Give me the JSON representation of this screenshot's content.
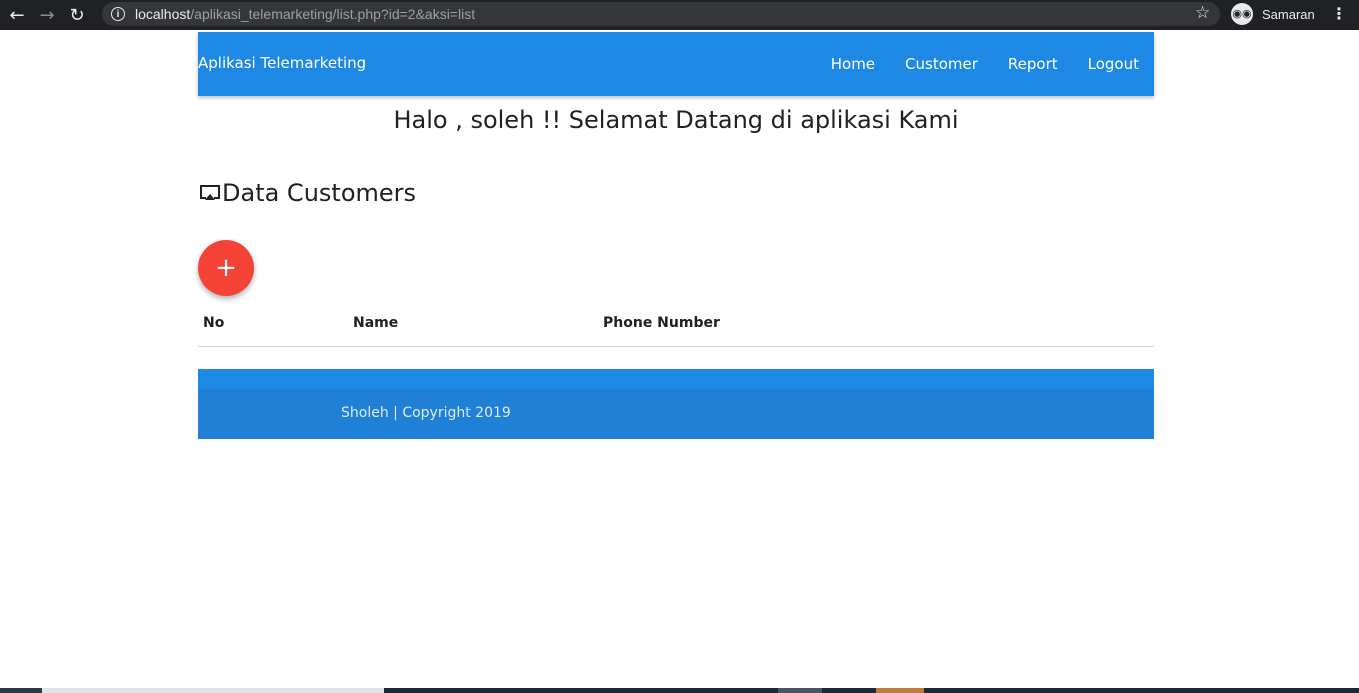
{
  "browser": {
    "url_host": "localhost",
    "url_path": "/aplikasi_telemarketing/list.php?id=2&aksi=list",
    "profile_label": "Samaran",
    "icons": [
      "back-arrow-icon",
      "forward-arrow-icon",
      "reload-icon",
      "info-icon",
      "star-icon",
      "incognito-icon",
      "more-vert-icon"
    ]
  },
  "navbar": {
    "brand": "Aplikasi Telemarketing",
    "links": [
      "Home",
      "Customer",
      "Report",
      "Logout"
    ],
    "color": "#1e88e5"
  },
  "welcome": "Halo , soleh !! Selamat Datang di aplikasi Kami",
  "section": {
    "title": "Data Customers",
    "icon": "cast-icon"
  },
  "fab": {
    "icon": "plus-icon",
    "symbol": "+",
    "color": "#f44336"
  },
  "table": {
    "headers": [
      "No",
      "Name",
      "Phone Number"
    ],
    "rows": []
  },
  "footer": {
    "text": "Sholeh | Copyright 2019"
  }
}
